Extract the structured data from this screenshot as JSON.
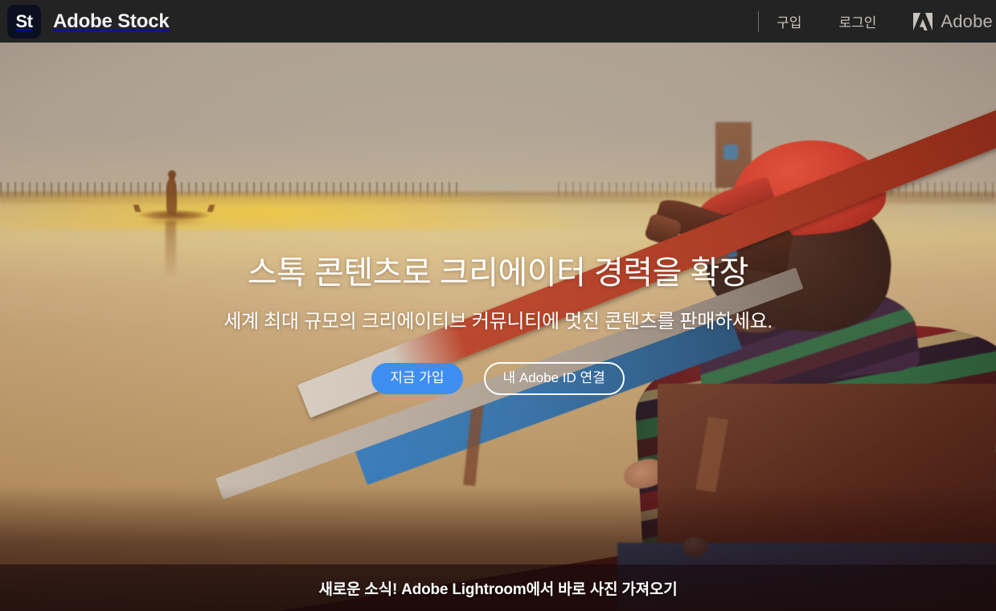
{
  "header": {
    "logo_text": "St",
    "brand_name": "Adobe Stock",
    "nav": [
      {
        "label": "구입"
      },
      {
        "label": "로그인"
      }
    ],
    "adobe_label": "Adobe",
    "bg_color": "#232323",
    "logo_bg_color": "#0b1021"
  },
  "hero": {
    "title": "스톡 콘텐츠로 크리에이터 경력을 확장",
    "subtitle": "세계 최대 규모의 크리에이티브 커뮤니티에 멋진 콘텐츠를 판매하세요.",
    "primary_button": "지금 가입",
    "secondary_button": "내 Adobe ID 연결",
    "primary_button_color": "#3e8ef1"
  },
  "banner": {
    "text": "새로운 소식! Adobe Lightroom에서 바로 사진 가져오기"
  }
}
